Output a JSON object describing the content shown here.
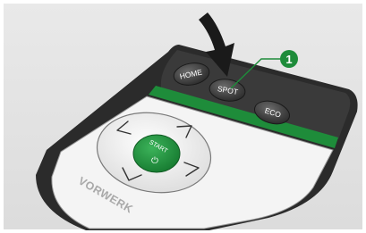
{
  "illustration": {
    "remote": {
      "buttons": {
        "home": "HOME",
        "spot": "SPOT",
        "eco": "ECO",
        "start": "START",
        "power_symbol": "⏻"
      },
      "brand": "VORWERK"
    },
    "callout": {
      "number": "1"
    },
    "colors": {
      "background": "#e6e6e6",
      "remote_body": "#2b2b2b",
      "remote_face": "#f4f4f4",
      "accent_green": "#1e8c3a",
      "arrow": "#1a1a1a"
    },
    "icons": [
      "press-arrow-icon",
      "arrow-up-left-icon",
      "arrow-up-right-icon",
      "arrow-down-left-icon",
      "arrow-down-right-icon",
      "power-icon"
    ]
  }
}
